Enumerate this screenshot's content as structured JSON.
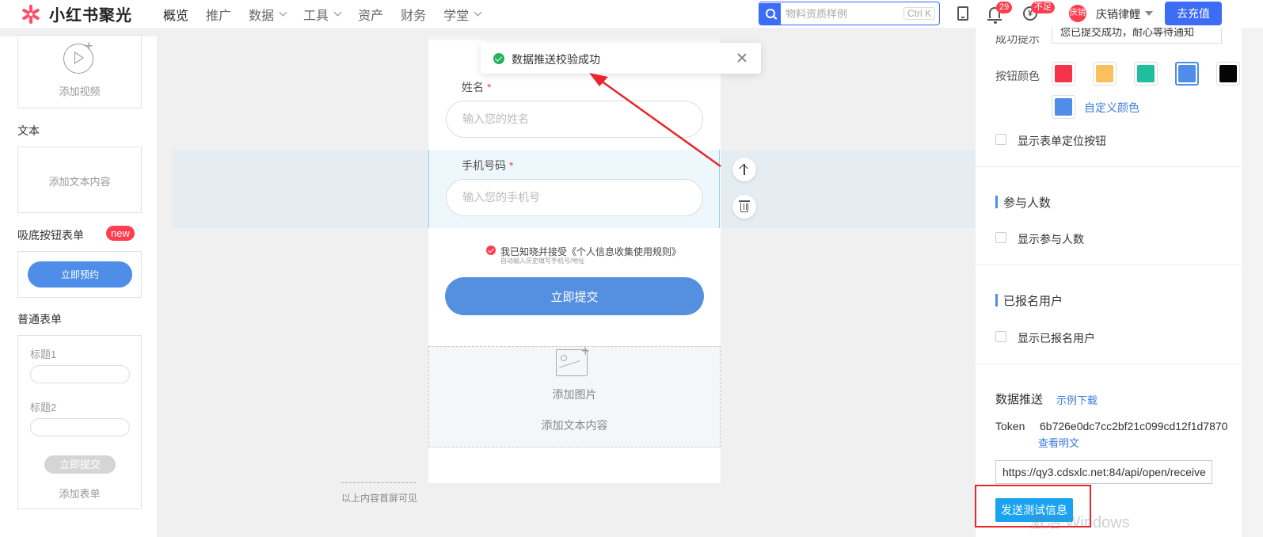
{
  "topnav": {
    "logo_text": "小红书聚光",
    "items": [
      {
        "label": "概览",
        "dropdown": false
      },
      {
        "label": "推广",
        "dropdown": false
      },
      {
        "label": "数据",
        "dropdown": true
      },
      {
        "label": "工具",
        "dropdown": true
      },
      {
        "label": "资产",
        "dropdown": false
      },
      {
        "label": "财务",
        "dropdown": false
      },
      {
        "label": "学堂",
        "dropdown": true
      }
    ],
    "search_placeholder": "物料资质样例",
    "search_shortcut": "Ctrl K",
    "bell_badge": "29",
    "coin_badge": "不足",
    "coin_glyph": "¥",
    "avatar_text": "庆销",
    "username": "庆销律鲤",
    "recharge_label": "去充值"
  },
  "left_panel": {
    "video_caption": "添加视频",
    "text_section": "文本",
    "text_caption": "添加文本内容",
    "sticky_form_section": "吸底按钮表单",
    "new_badge": "new",
    "sticky_button": "立即预约",
    "normal_form_section": "普通表单",
    "form_title1": "标题1",
    "form_title2": "标题2",
    "form_submit": "立即提交",
    "form_caption": "添加表单"
  },
  "canvas": {
    "name_label": "姓名",
    "name_placeholder": "输入您的姓名",
    "phone_label": "手机号码",
    "phone_placeholder": "输入您的手机号",
    "required_mark": "*",
    "consent_text": "我已知晓并接受《个人信息收集使用规则》",
    "consent_sub": "自动输入历史填写手机号/地址",
    "submit_label": "立即提交",
    "add_image": "添加图片",
    "add_text": "添加文本内容",
    "fold_text": "以上内容首屏可见"
  },
  "toast": {
    "message": "数据推送校验成功"
  },
  "right_panel": {
    "success_tip_label": "成功提示",
    "success_tip_value": "您已提交成功，耐心等待通知",
    "button_color_label": "按钮颜色",
    "swatches": [
      "#f5334a",
      "#fbbf5e",
      "#1ebfa0",
      "#4e8de8",
      "#050505"
    ],
    "selected_swatch": 3,
    "custom_swatch_color": "#4e8de8",
    "custom_color_link": "自定义颜色",
    "show_locate_button": "显示表单定位按钮",
    "participants_heading": "参与人数",
    "show_participants": "显示参与人数",
    "registered_heading": "已报名用户",
    "show_registered": "显示已报名用户",
    "push_title": "数据推送",
    "sample_download": "示例下载",
    "token_label": "Token",
    "token_value": "6b726e0dc7cc2bf21c099cd12f1d7870",
    "view_plain": "查看明文",
    "url_value": "https://qy3.cdsxlc.net:84/api/open/receive",
    "send_test": "发送测试信息"
  },
  "watermark": "激活 Windows",
  "colors": {
    "accent": "#3d6cf5",
    "annotation_red": "#e8262c",
    "success_green": "#21b35d"
  }
}
